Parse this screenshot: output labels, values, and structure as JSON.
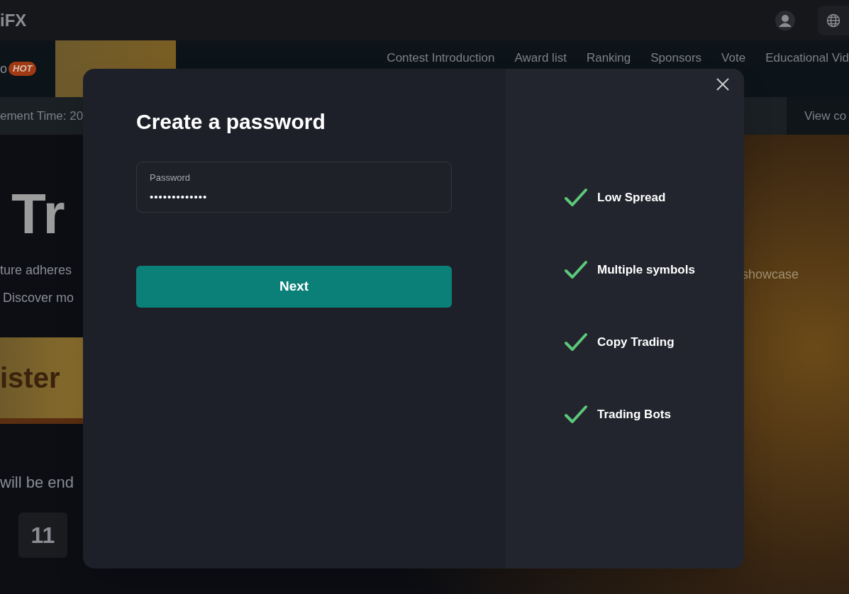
{
  "header": {
    "logo": "iFX"
  },
  "nav": {
    "tab": "o",
    "badge": "HOT",
    "items": [
      "Contest Introduction",
      "Award list",
      "Ranking",
      "Sponsors",
      "Vote",
      "Educational Vid"
    ]
  },
  "info_bar": {
    "text": "ement Time: 20",
    "link": "View co"
  },
  "hero": {
    "title": "Tr",
    "lines": [
      "ture adheres",
      "Discover mo"
    ],
    "button": "ister",
    "countdown_text": "will be end",
    "countdown": [
      "11"
    ],
    "right_text": "showcase"
  },
  "modal": {
    "title": "Create a password",
    "field": {
      "label": "Password",
      "value": "•••••••••••••"
    },
    "button": "Next",
    "features": [
      "Low Spread",
      "Multiple symbols",
      "Copy Trading",
      "Trading Bots"
    ]
  }
}
